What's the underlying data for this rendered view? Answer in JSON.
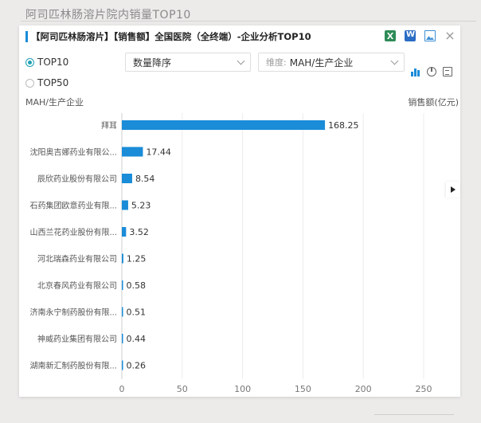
{
  "page_title": "阿司匹林肠溶片院内销量TOP10",
  "panel": {
    "title": "【阿司匹林肠溶片】【销售额】全国医院（全终端）-企业分析TOP10"
  },
  "options": {
    "top10_label": "TOP10",
    "top50_label": "TOP50",
    "sort_value": "数量降序",
    "dimension_prefix": "维度:",
    "dimension_value": "MAH/生产企业"
  },
  "icons": {
    "header": [
      "excel-icon",
      "word-icon",
      "image-icon",
      "close-icon"
    ],
    "chart_types": [
      "bar-chart-icon",
      "pie-chart-icon",
      "table-icon"
    ]
  },
  "colors": {
    "bar": "#1a8cd8",
    "accent": "#1a8cd8",
    "radio": "#1fa0b5"
  },
  "chart_data": {
    "type": "bar",
    "orientation": "horizontal",
    "ylabel": "MAH/生产企业",
    "xlabel": "销售额(亿元)",
    "categories": [
      "拜耳",
      "沈阳奥吉娜药业有限公...",
      "辰欣药业股份有限公司",
      "石药集团欧意药业有限...",
      "山西兰花药业股份有限...",
      "河北瑞森药业有限公司",
      "北京春风药业有限公司",
      "济南永宁制药股份有限...",
      "神威药业集团有限公司",
      "湖南新汇制药股份有限..."
    ],
    "values": [
      168.25,
      17.44,
      8.54,
      5.23,
      3.52,
      1.25,
      0.58,
      0.51,
      0.44,
      0.26
    ],
    "value_labels": [
      "168.25",
      "17.44",
      "8.54",
      "5.23",
      "3.52",
      "1.25",
      "0.58",
      "0.51",
      "0.44",
      "0.26"
    ],
    "xlim": [
      0,
      250
    ],
    "xticks": [
      "0",
      "50",
      "100",
      "150",
      "200",
      "250"
    ],
    "grid": true
  }
}
